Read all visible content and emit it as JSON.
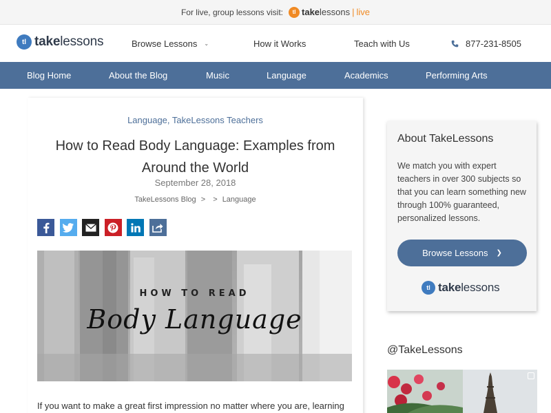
{
  "promo": {
    "text": "For live, group lessons visit:",
    "brand_bold": "take",
    "brand_rest": "lessons",
    "separator": "|",
    "live": "live",
    "accent": "#f08a24"
  },
  "header": {
    "logo_bold": "take",
    "logo_rest": "lessons",
    "logo_mark": "tl",
    "nav": {
      "browse": "Browse Lessons",
      "how": "How it Works",
      "teach": "Teach with Us",
      "phone": "877-231-8505"
    }
  },
  "catnav": {
    "color": "#4d6f99",
    "items": [
      "Blog Home",
      "About the Blog",
      "Music",
      "Language",
      "Academics",
      "Performing Arts"
    ]
  },
  "article": {
    "categories": [
      "Language",
      "TakeLessons Teachers"
    ],
    "category_separator": ", ",
    "title": "How to Read Body Language: Examples from Around the World",
    "date": "September 28, 2018",
    "breadcrumb": [
      "TakeLessons Blog",
      "Language"
    ],
    "share": [
      "facebook-icon",
      "twitter-icon",
      "email-icon",
      "pinterest-icon",
      "linkedin-icon",
      "share-icon"
    ],
    "hero": {
      "top_text": "HOW TO READ",
      "main_text": "Body Language"
    },
    "intro": "If you want to make a great first impression no matter where you are, learning"
  },
  "sidebar": {
    "about_title": "About TakeLessons",
    "about_text": "We match you with expert teachers in over 300 subjects so that you can learn something new through 100% guaranteed, personalized lessons.",
    "cta": "Browse Lessons",
    "social_title": "@TakeLessons"
  }
}
